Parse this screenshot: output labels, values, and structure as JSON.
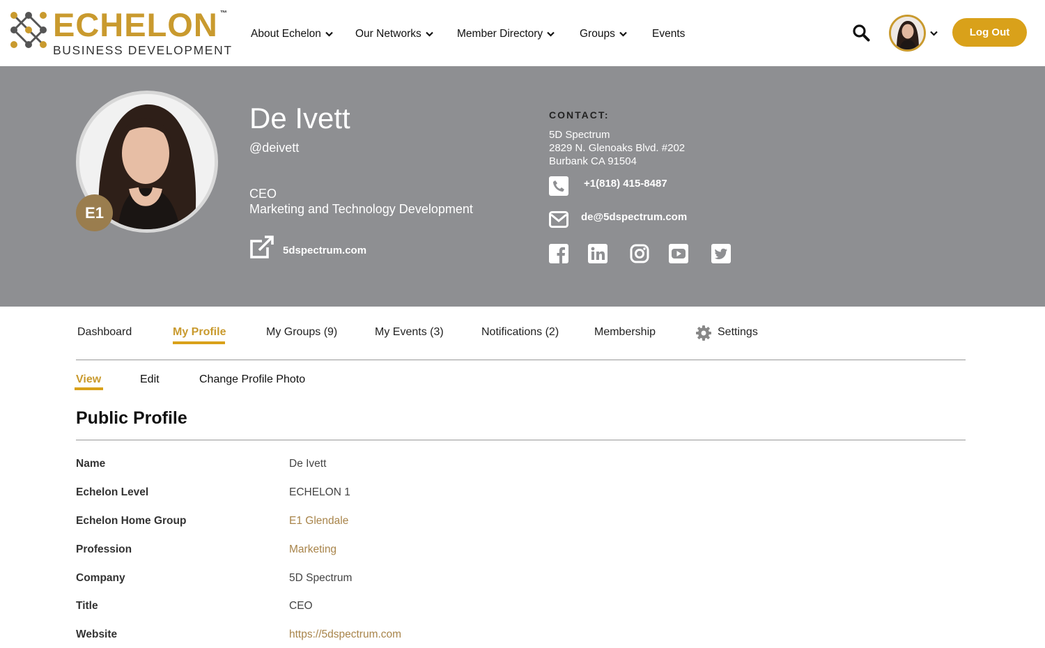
{
  "brand": {
    "word": "ECHELON",
    "tm": "™",
    "sub": "BUSINESS DEVELOPMENT",
    "gold": "#c99a2e",
    "accent_button": "#d9a11a"
  },
  "nav": {
    "items": [
      {
        "label": "About Echelon",
        "dropdown": true
      },
      {
        "label": "Our Networks",
        "dropdown": true
      },
      {
        "label": "Member Directory",
        "dropdown": true
      },
      {
        "label": "Groups",
        "dropdown": true
      },
      {
        "label": "Events",
        "dropdown": false
      }
    ],
    "logout": "Log Out"
  },
  "profile": {
    "name": "De Ivett",
    "handle": "@deivett",
    "level_badge": "E1",
    "title": "CEO",
    "department": "Marketing and Technology Development",
    "website": "5dspectrum.com",
    "contact": {
      "heading": "CONTACT:",
      "address_lines": [
        "5D Spectrum",
        "2829 N. Glenoaks Blvd. #202",
        "Burbank CA 91504"
      ],
      "phone": "+1(818) 415-8487",
      "email": "de@5dspectrum.com"
    },
    "social": [
      "facebook-icon",
      "linkedin-icon",
      "instagram-icon",
      "youtube-icon",
      "twitter-icon"
    ],
    "hero_bg": "#8e8f92"
  },
  "tabs": [
    {
      "label": "Dashboard",
      "active": false
    },
    {
      "label": "My Profile",
      "active": true
    },
    {
      "label": "My Groups (9)",
      "active": false
    },
    {
      "label": "My Events (3)",
      "active": false
    },
    {
      "label": "Notifications (2)",
      "active": false
    },
    {
      "label": "Membership",
      "active": false
    },
    {
      "label": "Settings",
      "active": false
    }
  ],
  "subtabs": [
    {
      "label": "View",
      "active": true
    },
    {
      "label": "Edit",
      "active": false
    },
    {
      "label": "Change Profile Photo",
      "active": false
    }
  ],
  "section_title": "Public Profile",
  "fields": [
    {
      "label": "Name",
      "value": "De Ivett",
      "link": false
    },
    {
      "label": "Echelon Level",
      "value": "ECHELON 1",
      "link": false
    },
    {
      "label": "Echelon Home Group",
      "value": "E1 Glendale",
      "link": true
    },
    {
      "label": "Profession",
      "value": "Marketing",
      "link": true
    },
    {
      "label": "Company",
      "value": "5D Spectrum",
      "link": false
    },
    {
      "label": "Title",
      "value": "CEO",
      "link": false
    },
    {
      "label": "Website",
      "value": "https://5dspectrum.com",
      "link": true
    }
  ]
}
